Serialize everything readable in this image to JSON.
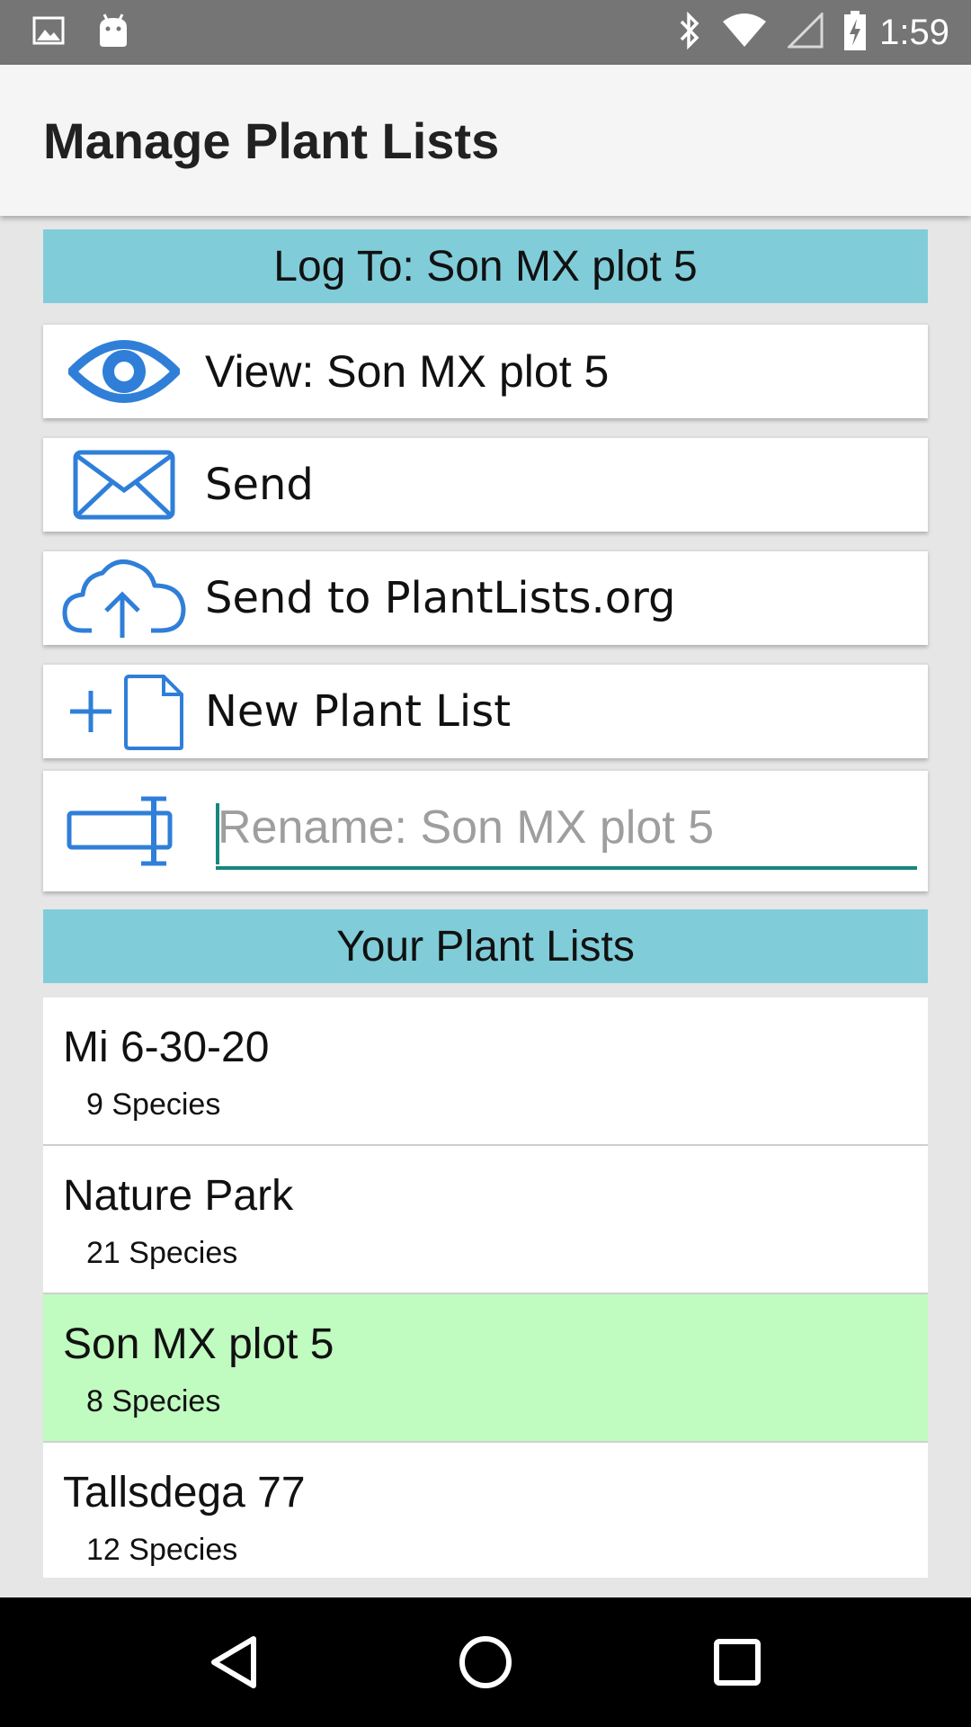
{
  "status_bar": {
    "time": "1:59",
    "left_icons": [
      "image-notification-icon",
      "android-notification-icon"
    ],
    "right_icons": [
      "bluetooth-icon",
      "wifi-icon",
      "cell-signal-icon",
      "battery-charging-icon"
    ]
  },
  "app_bar": {
    "title": "Manage Plant Lists"
  },
  "log_header": {
    "label": "Log To: Son MX plot 5"
  },
  "actions": {
    "view": {
      "label": "View: Son MX plot 5",
      "icon": "eye-icon"
    },
    "send": {
      "label": "Send",
      "icon": "envelope-icon"
    },
    "send_plantlists": {
      "label": "Send to PlantLists.org",
      "icon": "cloud-upload-icon"
    },
    "new_list": {
      "label": "New Plant List",
      "icon": "new-document-icon"
    },
    "rename": {
      "placeholder": "Rename: Son MX plot 5",
      "value": "",
      "icon": "rename-icon"
    }
  },
  "lists_header": {
    "label": "Your Plant Lists"
  },
  "plant_lists": [
    {
      "name": "Mi 6-30-20",
      "count": "9 Species",
      "selected": false
    },
    {
      "name": "Nature Park",
      "count": "21 Species",
      "selected": false
    },
    {
      "name": "Son MX plot 5",
      "count": "8 Species",
      "selected": true
    },
    {
      "name": "Tallsdega 77",
      "count": "12 Species",
      "selected": false
    }
  ],
  "colors": {
    "status_bar": "#757575",
    "app_bar": "#f5f5f5",
    "section_header": "#80cdd9",
    "selected_row": "#c0fbbf",
    "icon_blue": "#2f7fd8",
    "input_underline": "#17877e"
  },
  "nav_bar": {
    "buttons": [
      "back-icon",
      "home-icon",
      "recents-icon"
    ]
  }
}
